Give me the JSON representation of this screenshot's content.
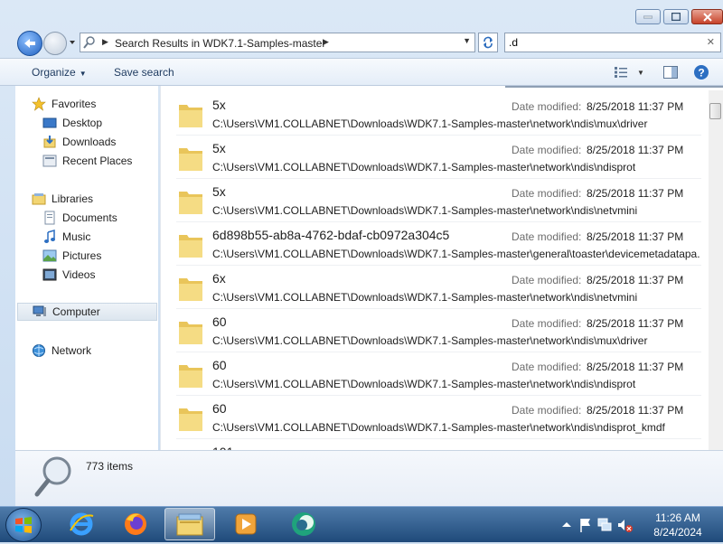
{
  "window": {
    "address_crumb": "Search Results in WDK7.1-Samples-master",
    "search_value": ".d"
  },
  "toolbar": {
    "organize_label": "Organize",
    "save_search_label": "Save search"
  },
  "navpane": {
    "favorites_label": "Favorites",
    "favorites": [
      {
        "label": "Desktop",
        "icon": "desktop-icon"
      },
      {
        "label": "Downloads",
        "icon": "downloads-icon"
      },
      {
        "label": "Recent Places",
        "icon": "recent-places-icon"
      }
    ],
    "libraries_label": "Libraries",
    "libraries": [
      {
        "label": "Documents",
        "icon": "documents-icon"
      },
      {
        "label": "Music",
        "icon": "music-icon"
      },
      {
        "label": "Pictures",
        "icon": "pictures-icon"
      },
      {
        "label": "Videos",
        "icon": "videos-icon"
      }
    ],
    "computer_label": "Computer",
    "network_label": "Network"
  },
  "results": {
    "date_label": "Date modified:",
    "items": [
      {
        "name": "5x",
        "path": "C:\\Users\\VM1.COLLABNET\\Downloads\\WDK7.1-Samples-master\\network\\ndis\\mux\\driver",
        "date": "8/25/2018 11:37 PM"
      },
      {
        "name": "5x",
        "path": "C:\\Users\\VM1.COLLABNET\\Downloads\\WDK7.1-Samples-master\\network\\ndis\\ndisprot",
        "date": "8/25/2018 11:37 PM"
      },
      {
        "name": "5x",
        "path": "C:\\Users\\VM1.COLLABNET\\Downloads\\WDK7.1-Samples-master\\network\\ndis\\netvmini",
        "date": "8/25/2018 11:37 PM"
      },
      {
        "name": "6d898b55-ab8a-4762-bdaf-cb0972a304c5",
        "path": "C:\\Users\\VM1.COLLABNET\\Downloads\\WDK7.1-Samples-master\\general\\toaster\\devicemetadatapa...",
        "date": "8/25/2018 11:37 PM"
      },
      {
        "name": "6x",
        "path": "C:\\Users\\VM1.COLLABNET\\Downloads\\WDK7.1-Samples-master\\network\\ndis\\netvmini",
        "date": "8/25/2018 11:37 PM"
      },
      {
        "name": "60",
        "path": "C:\\Users\\VM1.COLLABNET\\Downloads\\WDK7.1-Samples-master\\network\\ndis\\mux\\driver",
        "date": "8/25/2018 11:37 PM"
      },
      {
        "name": "60",
        "path": "C:\\Users\\VM1.COLLABNET\\Downloads\\WDK7.1-Samples-master\\network\\ndis\\ndisprot",
        "date": "8/25/2018 11:37 PM"
      },
      {
        "name": "60",
        "path": "C:\\Users\\VM1.COLLABNET\\Downloads\\WDK7.1-Samples-master\\network\\ndis\\ndisprot_kmdf",
        "date": "8/25/2018 11:37 PM"
      }
    ],
    "partial_next_name": "101"
  },
  "details": {
    "item_count": "773 items"
  },
  "taskbar": {
    "apps": [
      {
        "name": "internet-explorer-icon"
      },
      {
        "name": "firefox-icon"
      },
      {
        "name": "file-explorer-icon",
        "active": true
      },
      {
        "name": "media-player-icon"
      },
      {
        "name": "app-icon"
      }
    ],
    "clock_time": "11:26 AM",
    "clock_date": "8/24/2024"
  },
  "colors": {
    "window_bg": "#cfe0f2",
    "taskbar": "#2a5688",
    "folder": "#f2d573"
  }
}
